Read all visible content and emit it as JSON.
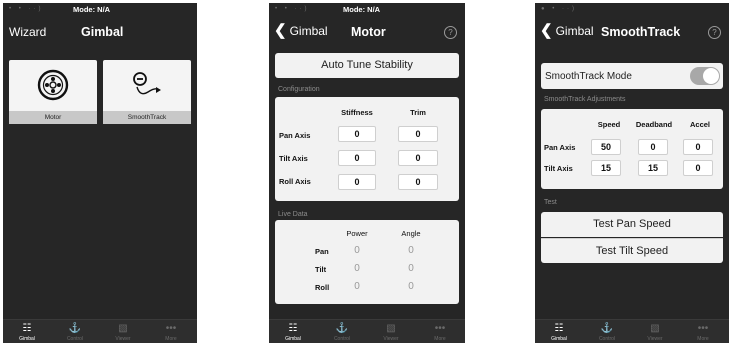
{
  "screens": [
    {
      "status": {
        "icons": "• • ··)",
        "mode": "Mode: N/A"
      },
      "nav": {
        "left": "Wizard",
        "title": "Gimbal"
      },
      "tiles": [
        {
          "label": "Motor",
          "icon": "motor-icon"
        },
        {
          "label": "SmoothTrack",
          "icon": "smoothtrack-icon"
        }
      ]
    },
    {
      "status": {
        "icons": "• • ··)",
        "mode": "Mode: N/A"
      },
      "nav": {
        "back": "Gimbal",
        "title": "Motor",
        "help": "?"
      },
      "auto_tune": "Auto Tune Stability",
      "config": {
        "header": "Configuration",
        "columns": [
          "Stiffness",
          "Trim"
        ],
        "rows": [
          {
            "label": "Pan Axis",
            "stiffness": "0",
            "trim": "0"
          },
          {
            "label": "Tilt Axis",
            "stiffness": "0",
            "trim": "0"
          },
          {
            "label": "Roll Axis",
            "stiffness": "0",
            "trim": "0"
          }
        ]
      },
      "live": {
        "header": "Live Data",
        "columns": [
          "Power",
          "Angle"
        ],
        "rows": [
          {
            "label": "Pan",
            "power": "0",
            "angle": "0"
          },
          {
            "label": "Tilt",
            "power": "0",
            "angle": "0"
          },
          {
            "label": "Roll",
            "power": "0",
            "angle": "0"
          }
        ]
      }
    },
    {
      "status": {
        "icons": "● • ··)"
      },
      "nav": {
        "back": "Gimbal",
        "title": "SmoothTrack",
        "help": "?"
      },
      "mode_label": "SmoothTrack Mode",
      "adjust": {
        "header": "SmoothTrack Adjustments",
        "columns": [
          "Speed",
          "Deadband",
          "Accel"
        ],
        "rows": [
          {
            "label": "Pan Axis",
            "speed": "50",
            "deadband": "0",
            "accel": "0"
          },
          {
            "label": "Tilt Axis",
            "speed": "15",
            "deadband": "15",
            "accel": "0"
          }
        ]
      },
      "test": {
        "header": "Test",
        "buttons": [
          "Test Pan Speed",
          "Test Tilt Speed"
        ]
      }
    }
  ],
  "tabbar": {
    "tabs": [
      {
        "label": "Gimbal",
        "icon": "gimbal-icon"
      },
      {
        "label": "Control",
        "icon": "joystick-icon"
      },
      {
        "label": "Viewer",
        "icon": "viewer-icon"
      },
      {
        "label": "More",
        "icon": "more-icon"
      }
    ]
  },
  "colors": {
    "background": "#262626",
    "panel": "#f2f2f2",
    "tile_label": "#c8c8c8",
    "toggle": "#a8a8a8"
  }
}
